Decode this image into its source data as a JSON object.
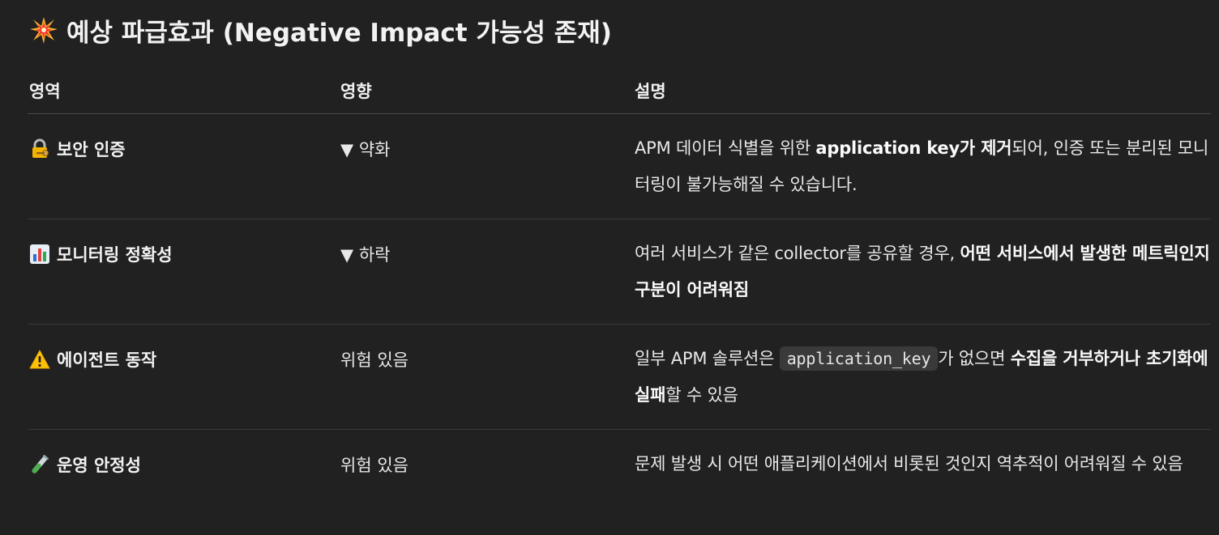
{
  "heading": {
    "icon": "collision-icon",
    "text": "예상 파급효과 (Negative Impact 가능성 존재)"
  },
  "table": {
    "headers": [
      "영역",
      "영향",
      "설명"
    ],
    "rows": [
      {
        "icon": "locked-with-key-icon",
        "area": "보안 인증",
        "impact": "▼ 약화",
        "desc": [
          {
            "t": "APM 데이터 식별을 위한 ",
            "b": false
          },
          {
            "t": "application key가 제거",
            "b": true
          },
          {
            "t": "되어, 인증 또는 분리된 모니터링이 불가능해질 수 있습니다.",
            "b": false
          }
        ]
      },
      {
        "icon": "bar-chart-icon",
        "area": "모니터링 정확성",
        "impact": "▼ 하락",
        "desc": [
          {
            "t": "여러 서비스가 같은 collector를 공유할 경우, ",
            "b": false
          },
          {
            "t": "어떤 서비스에서 발생한 메트릭인지 구분이 어려워짐",
            "b": true
          }
        ]
      },
      {
        "icon": "warning-icon",
        "area": "에이전트 동작",
        "impact": "위험 있음",
        "desc": [
          {
            "t": "일부 APM 솔루션은 ",
            "b": false
          },
          {
            "t": "application_key",
            "code": true
          },
          {
            "t": "가 없으면 ",
            "b": false
          },
          {
            "t": "수집을 거부하거나 초기화에 실패",
            "b": true
          },
          {
            "t": "할 수 있음",
            "b": false
          }
        ]
      },
      {
        "icon": "test-tube-icon",
        "area": "운영 안정성",
        "impact": "위험 있음",
        "desc": [
          {
            "t": "문제 발생 시 어떤 애플리케이션에서 비롯된 것인지 역추적이 어려워질 수 있음",
            "b": false
          }
        ]
      }
    ]
  }
}
